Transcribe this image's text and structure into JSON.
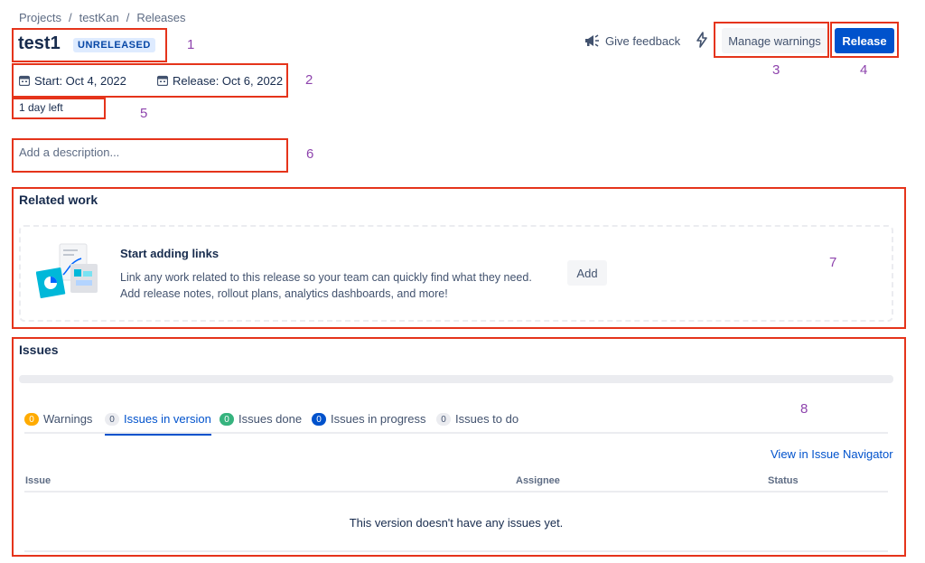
{
  "breadcrumb": [
    "Projects",
    "testKan",
    "Releases"
  ],
  "breadcrumb_separator": "/",
  "version": {
    "name": "test1",
    "status": "UNRELEASED"
  },
  "header": {
    "feedback_label": "Give feedback",
    "manage_warnings_label": "Manage warnings",
    "release_label": "Release"
  },
  "dates": {
    "start": "Start: Oct 4, 2022",
    "release": "Release: Oct 6, 2022"
  },
  "days_left": "1 day left",
  "description_placeholder": "Add a description...",
  "related_work": {
    "title": "Related work",
    "card_title": "Start adding links",
    "card_line1": "Link any work related to this release so your team can quickly find what they need.",
    "card_line2": "Add release notes, rollout plans, analytics dashboards, and more!",
    "add_label": "Add"
  },
  "issues": {
    "title": "Issues",
    "progress": 0,
    "tabs": [
      {
        "count": "0",
        "label": "Warnings",
        "color": "#ffab00",
        "text_color": "#ffffff"
      },
      {
        "count": "0",
        "label": "Issues in version",
        "color": "#ebecf0",
        "text_color": "#42526e"
      },
      {
        "count": "0",
        "label": "Issues done",
        "color": "#36b37e",
        "text_color": "#ffffff"
      },
      {
        "count": "0",
        "label": "Issues in progress",
        "color": "#0052cc",
        "text_color": "#ffffff"
      },
      {
        "count": "0",
        "label": "Issues to do",
        "color": "#ebecf0",
        "text_color": "#42526e"
      }
    ],
    "navigator_link": "View in Issue Navigator",
    "columns": [
      "Issue",
      "Assignee",
      "Status"
    ],
    "empty_message": "This version doesn't have any issues yet."
  },
  "annotations": [
    "1",
    "2",
    "3",
    "4",
    "5",
    "6",
    "7",
    "8"
  ],
  "colors": {
    "accent": "#0052cc",
    "annotation_box": "#e5341b",
    "annotation_number": "#8e44ad"
  }
}
